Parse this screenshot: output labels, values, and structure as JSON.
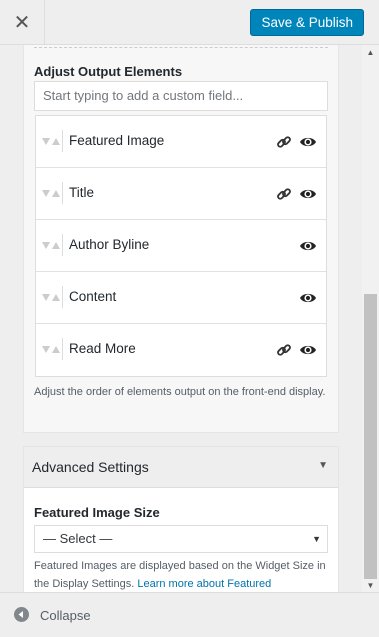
{
  "header": {
    "close_icon": "close-icon",
    "publish_label": "Save & Publish"
  },
  "output_elements": {
    "title": "Adjust Output Elements",
    "custom_field_placeholder": "Start typing to add a custom field...",
    "items": [
      {
        "label": "Featured Image",
        "link": true
      },
      {
        "label": "Title",
        "link": true
      },
      {
        "label": "Author Byline",
        "link": false
      },
      {
        "label": "Content",
        "link": false
      },
      {
        "label": "Read More",
        "link": true
      }
    ],
    "help": "Adjust the order of elements output on the front-end display."
  },
  "advanced": {
    "title": "Advanced Settings",
    "featured_size_label": "Featured Image Size",
    "select_value": "— Select —",
    "help_text": "Featured Images are displayed based on the Widget Size in the Display Settings. ",
    "help_link": "Learn more about Featured"
  },
  "footer": {
    "collapse_label": "Collapse"
  },
  "colors": {
    "primary": "#0085ba",
    "link": "#0073aa"
  }
}
